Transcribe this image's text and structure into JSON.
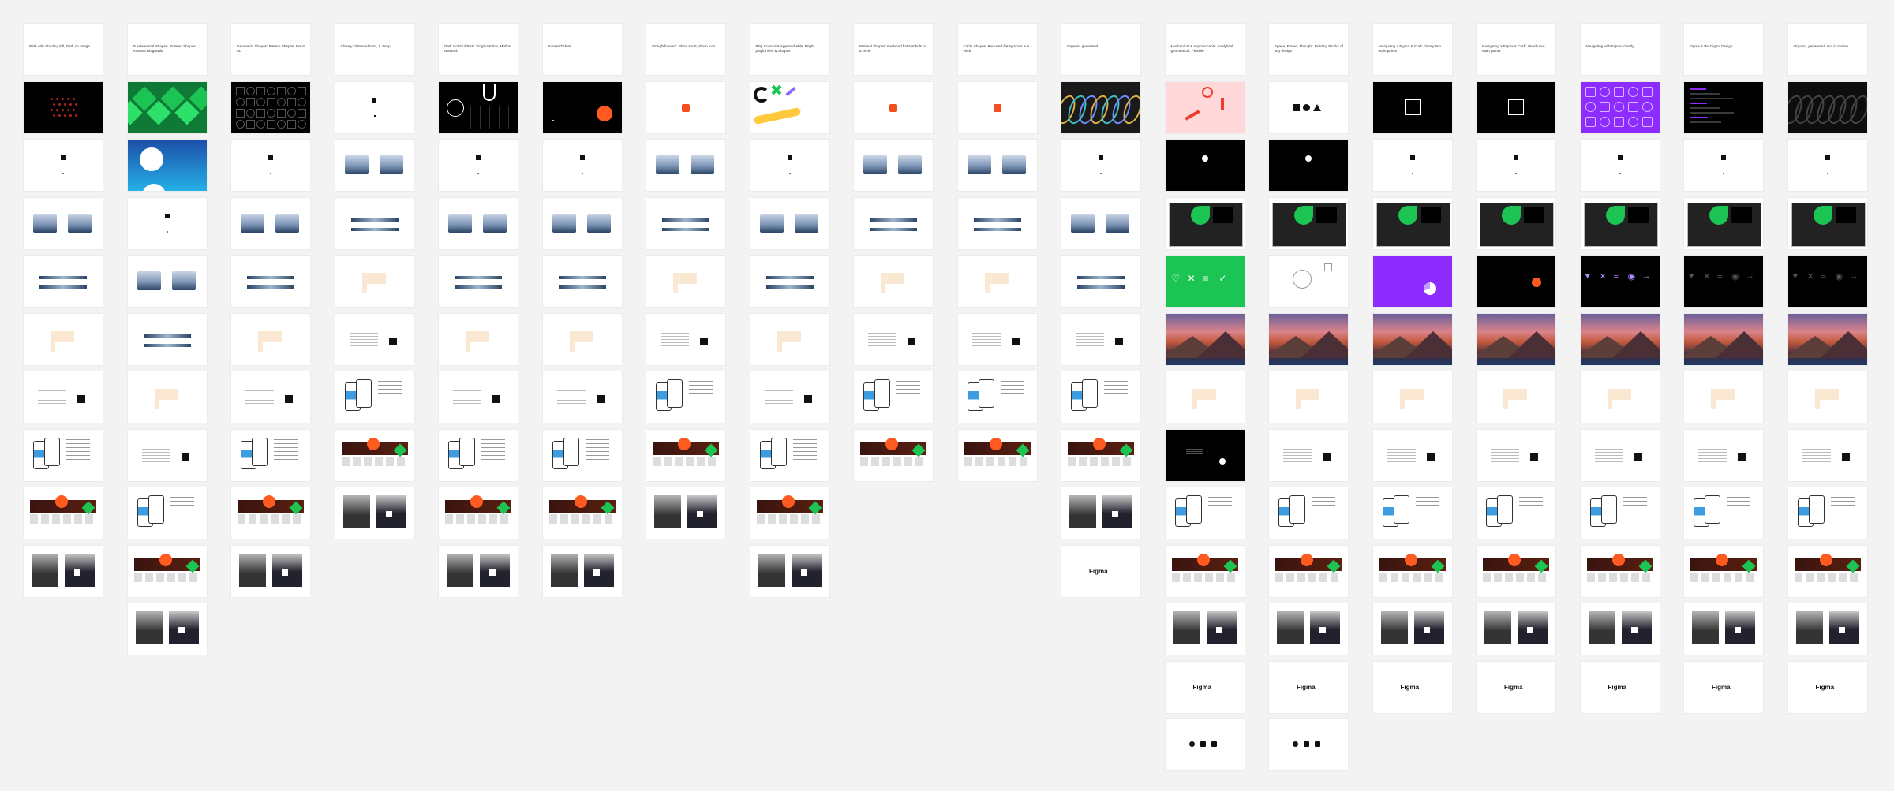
{
  "colors": {
    "background": "#f3f3f3",
    "frame": "#ffffff",
    "dark": "#000000",
    "green": "#1bc453",
    "purple": "#8c2cff",
    "red": "#f24e1e",
    "orange": "#ff5a1f",
    "pink": "#ffd9d9"
  },
  "columns": [
    {
      "title": "Path with Shading Fill, Dark on Image",
      "cover": "dark-red-dots",
      "frames": [
        "title",
        "cover",
        "icon",
        "shots",
        "timeline",
        "peach",
        "textbox",
        "phones",
        "website",
        "people"
      ]
    },
    {
      "title": "Fundamental Shapes: Rotated Shapes, Rotated Diagonals",
      "cover": "green-chevrons",
      "frames": [
        "title",
        "cover",
        "gradient",
        "icon",
        "shots",
        "timeline",
        "peach",
        "textbox",
        "phones",
        "website",
        "people"
      ]
    },
    {
      "title": "Geometric Shapes: Pattern Shapes, Mono 01",
      "cover": "dark-pattern",
      "frames": [
        "title",
        "cover",
        "icon",
        "shots",
        "timeline",
        "peach",
        "textbox",
        "phones",
        "website",
        "people"
      ]
    },
    {
      "title": "Closely Flattened Icon, 1 Jump",
      "cover": "white-square",
      "frames": [
        "title",
        "cover",
        "shots",
        "timeline",
        "peach",
        "textbox",
        "phones",
        "website",
        "people"
      ]
    },
    {
      "title": "Dark Colorful Tech: Single Motion, Motion Network",
      "cover": "dark-circle",
      "frames": [
        "title",
        "cover",
        "icon",
        "shots",
        "timeline",
        "peach",
        "textbox",
        "phones",
        "website",
        "people"
      ]
    },
    {
      "title": "Sunset Tickets",
      "cover": "dark-orange",
      "frames": [
        "title",
        "cover",
        "icon",
        "shots",
        "timeline",
        "peach",
        "textbox",
        "phones",
        "website",
        "people"
      ]
    },
    {
      "title": "Straightforward: Plain, short, sharp icon",
      "cover": "red-icon",
      "frames": [
        "title",
        "cover",
        "shots",
        "timeline",
        "peach",
        "textbox",
        "phones",
        "website",
        "people"
      ]
    },
    {
      "title": "Play Colorful & Approachable: Bright playful with & Shapes",
      "cover": "playful",
      "frames": [
        "title",
        "cover",
        "icon",
        "shots",
        "timeline",
        "peach",
        "textbox",
        "phones",
        "website",
        "people"
      ]
    },
    {
      "title": "Minimal Shapes: Reduced flat symbols in a circle",
      "cover": "red-icon",
      "frames": [
        "title",
        "cover",
        "shots",
        "timeline",
        "peach",
        "textbox",
        "phones",
        "website"
      ]
    },
    {
      "title": "Circle Shapes: Reduced flat symbols in a circle",
      "cover": "red-icon",
      "frames": [
        "title",
        "cover",
        "shots",
        "timeline",
        "peach",
        "textbox",
        "phones",
        "website"
      ]
    },
    {
      "title": "Organic, generated",
      "cover": "ribbon",
      "frames": [
        "title",
        "cover",
        "icon",
        "shots",
        "timeline",
        "textbox",
        "phones",
        "website",
        "people",
        "logo"
      ]
    },
    {
      "title": "Mechanical & approachable: Analytical, geometrical, Flexible",
      "cover": "pink-shapes",
      "frames": [
        "title",
        "cover",
        "dark",
        "figma-ui",
        "green",
        "mountain",
        "peach",
        "dark-text",
        "phones",
        "website",
        "people",
        "logo",
        "icons3"
      ]
    },
    {
      "title": "Space, Frame, Thought: Building Blocks of any design",
      "cover": "shapes",
      "frames": [
        "title",
        "cover",
        "dark",
        "figma-ui",
        "sketch",
        "mountain",
        "peach",
        "textbox",
        "phones",
        "website",
        "people",
        "logo",
        "icons3"
      ]
    },
    {
      "title": "Navigating a Figma & Craft: clearly two main points",
      "cover": "black-arrow",
      "frames": [
        "title",
        "cover",
        "icon",
        "figma-ui",
        "purple",
        "mountain",
        "peach",
        "textbox",
        "phones",
        "website",
        "people",
        "logo"
      ]
    },
    {
      "title": "Navigating a Figma & Craft: clearly two main points",
      "cover": "black-frame",
      "frames": [
        "title",
        "cover",
        "icon",
        "figma-ui",
        "dark-orange",
        "mountain",
        "peach",
        "textbox",
        "phones",
        "website",
        "people",
        "logo"
      ]
    },
    {
      "title": "Navigating with Figma: clearly",
      "cover": "purple-pattern",
      "frames": [
        "title",
        "cover",
        "icon",
        "figma-ui",
        "dark-icons",
        "mountain",
        "peach",
        "textbox",
        "phones",
        "website",
        "people",
        "logo"
      ]
    },
    {
      "title": "Figma & the Digital Design",
      "cover": "dark-code",
      "frames": [
        "title",
        "cover",
        "icon",
        "figma-ui",
        "dark-icons",
        "mountain",
        "peach",
        "textbox",
        "phones",
        "website",
        "people",
        "logo"
      ]
    },
    {
      "title": "Organic, generated, and in motion",
      "cover": "dark-ribbon",
      "frames": [
        "title",
        "cover",
        "icon",
        "figma-ui",
        "dark-icons",
        "mountain",
        "peach",
        "textbox",
        "phones",
        "website",
        "people",
        "logo"
      ]
    }
  ],
  "logo": {
    "label": "Figma"
  }
}
